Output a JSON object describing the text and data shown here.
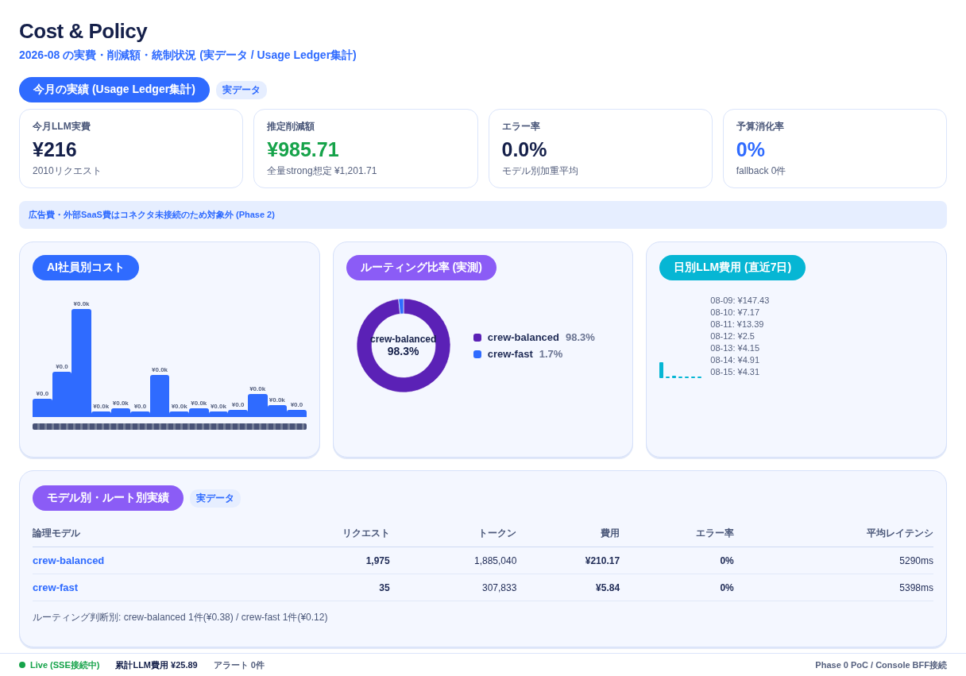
{
  "header": {
    "title": "Cost & Policy",
    "subtitle": "2026-08 の実費・削減額・統制状況 (実データ / Usage Ledger集計)"
  },
  "summary": {
    "section_label": "今月の実績 (Usage Ledger集計)",
    "badge": "実データ",
    "kpis": [
      {
        "label": "今月LLM実費",
        "value": "¥216",
        "note": "2010リクエスト",
        "color": "#15204a"
      },
      {
        "label": "推定削減額",
        "value": "¥985.71",
        "note": "全量strong想定 ¥1,201.71",
        "color": "#16a34a"
      },
      {
        "label": "エラー率",
        "value": "0.0%",
        "note": "モデル別加重平均",
        "color": "#15204a"
      },
      {
        "label": "予算消化率",
        "value": "0%",
        "note": "fallback 0件",
        "color": "#2f6bff"
      }
    ]
  },
  "notice": "広告費・外部SaaS費はコネクタ未接続のため対象外 (Phase 2)",
  "panels": [
    {
      "title": "AI社員別コスト",
      "kind": "bars",
      "bar_labels": [
        "¥0.0",
        "¥0.0",
        "¥0.0k",
        "¥0.0k",
        "¥0.0k",
        "¥0.0",
        "¥0.0k",
        "¥0.0k",
        "¥0.0k",
        "¥0.0k",
        "¥0.0",
        "¥0.0k",
        "¥0.0k",
        "¥0.0"
      ]
    },
    {
      "title": "ルーティング比率 (実測)",
      "kind": "donut",
      "center_label": "crew-balanced",
      "center_value": "98.3%",
      "legend": [
        {
          "value": "98.3%",
          "color": "#5b21b6"
        },
        {
          "value": "1.7%",
          "color": "#2f6bff"
        }
      ],
      "chart_data": {
        "type": "donut",
        "categories": [
          "crew-balanced",
          "crew-fast"
        ],
        "values": [
          98.3,
          1.7
        ]
      }
    },
    {
      "title": "日別LLM費用 (直近7日)",
      "kind": "daily",
      "entries": [
        "08-09: ¥147.43",
        "08-10: ¥7.17",
        "08-11: ¥13.39",
        "08-12: ¥2.5",
        "08-13: ¥4.15",
        "08-14: ¥4.91",
        "08-15: ¥4.31"
      ]
    }
  ],
  "models": {
    "title": "モデル別・ルート別実績",
    "badge": "実データ",
    "columns": [
      "論理モデル",
      "リクエスト",
      "トークン",
      "費用",
      "エラー率",
      "平均レイテンシ"
    ],
    "rows": [
      [
        "crew-balanced",
        "1,975",
        "1,885,040",
        "¥210.17",
        "0%",
        "5290ms"
      ],
      [
        "crew-fast",
        "35",
        "307,833",
        "¥5.84",
        "0%",
        "5398ms"
      ]
    ],
    "footnote": "ルーティング判断別: crew-balanced 1件(¥0.38) / crew-fast 1件(¥0.12)"
  },
  "status_bar": {
    "live": "Live (SSE接続中)",
    "total": "累計LLM費用 ¥25.89",
    "alerts": "アラート 0件",
    "right": "Phase 0 PoC / Console BFF接続"
  }
}
